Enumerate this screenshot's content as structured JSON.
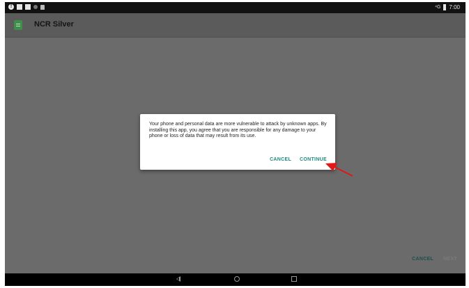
{
  "status_bar": {
    "time": "7:00",
    "signal_label": "⁴G",
    "alert_glyph": "!"
  },
  "app_bar": {
    "title": "NCR Silver"
  },
  "dialog": {
    "message": "Your phone and personal data are more vulnerable to attack by unknown apps. By installing this app, you agree that you are responsible for any damage to your phone or loss of data that may result from its use.",
    "cancel_label": "CANCEL",
    "continue_label": "CONTINUE"
  },
  "bottom_actions": {
    "cancel_label": "CANCEL",
    "next_label": "NEXT"
  },
  "colors": {
    "accent": "#1f8a80",
    "annotation_arrow": "#e01818",
    "scrim": "#6b6b6b"
  },
  "icons": {
    "nav_back": "back-icon",
    "nav_home": "home-icon",
    "nav_recent": "recents-icon",
    "app": "ncr-silver-app-icon"
  }
}
